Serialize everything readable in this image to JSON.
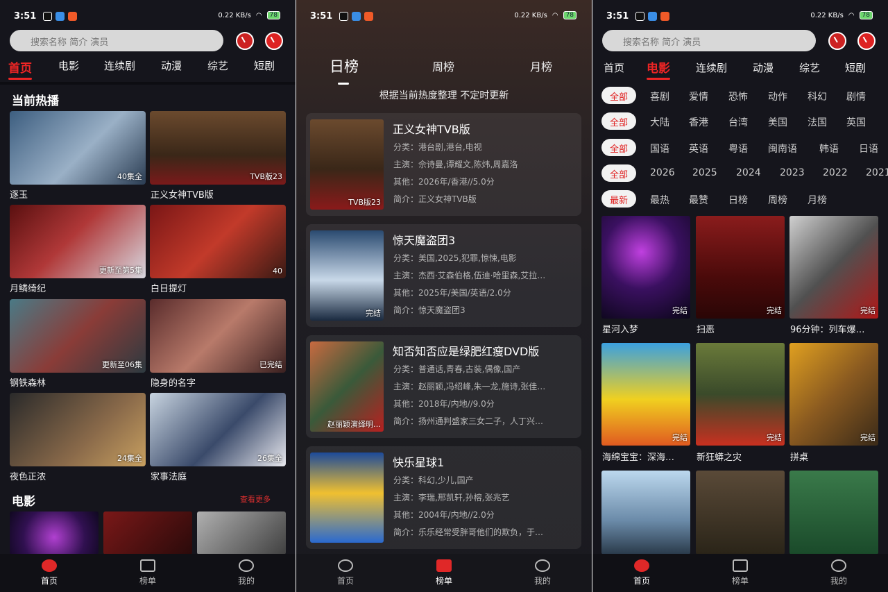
{
  "status": {
    "time": "3:51",
    "net_speed": "0.22 KB/s",
    "battery": "78"
  },
  "search": {
    "placeholder": "搜索名称 简介 演员"
  },
  "categories": [
    "首页",
    "电影",
    "连续剧",
    "动漫",
    "综艺",
    "短剧"
  ],
  "home": {
    "section_hot": "当前热播",
    "hot_items": [
      {
        "title": "逐玉",
        "badge": "40集全"
      },
      {
        "title": "正义女神TVB版",
        "badge": "TVB版23"
      },
      {
        "title": "月鳞绮纪",
        "badge": "更新至第5集"
      },
      {
        "title": "白日提灯",
        "badge": "40"
      },
      {
        "title": "钢铁森林",
        "badge": "更新至06集"
      },
      {
        "title": "隐身的名字",
        "badge": "已完结"
      },
      {
        "title": "夜色正浓",
        "badge": "24集全"
      },
      {
        "title": "家事法庭",
        "badge": "26集全"
      }
    ],
    "section_movie": "电影",
    "more_label": "查看更多"
  },
  "nav": [
    "首页",
    "榜单",
    "我的"
  ],
  "ranking": {
    "tabs": [
      "日榜",
      "周榜",
      "月榜"
    ],
    "subtitle": "根据当前热度整理 不定时更新",
    "items": [
      {
        "title": "正义女神TVB版",
        "category": "分类：港台剧,港台,电视",
        "cast": "主演：佘诗曼,谭耀文,陈炜,周嘉洛",
        "other": "其他：2026年/香港//5.0分",
        "intro": "简介：正义女神TVB版",
        "badge": "TVB版23"
      },
      {
        "title": "惊天魔盗团3",
        "category": "分类：美国,2025,犯罪,惊悚,电影",
        "cast": "主演：杰西·艾森伯格,伍迪·哈里森,艾拉…",
        "other": "其他：2025年/美国/英语/2.0分",
        "intro": "简介：惊天魔盗团3",
        "badge": "完结"
      },
      {
        "title": "知否知否应是绿肥红瘦DVD版",
        "category": "分类：普通话,青春,古装,偶像,国产",
        "cast": "主演：赵丽颖,冯绍峰,朱一龙,施诗,张佳…",
        "other": "其他：2018年/内地//9.0分",
        "intro": "简介：扬州通判盛家三女二子，人丁兴…",
        "badge": "赵丽颖演绎明…"
      },
      {
        "title": "快乐星球1",
        "category": "分类：科幻,少儿,国产",
        "cast": "主演：李瑞,邢凯轩,孙榕,张兆艺",
        "other": "其他：2004年/内地//2.0分",
        "intro": "简介：乐乐经常受胖哥他们的欺负，于…",
        "badge": ""
      }
    ]
  },
  "movies": {
    "filters": [
      {
        "chip": "全部",
        "options": [
          "喜剧",
          "爱情",
          "恐怖",
          "动作",
          "科幻",
          "剧情"
        ]
      },
      {
        "chip": "全部",
        "options": [
          "大陆",
          "香港",
          "台湾",
          "美国",
          "法国",
          "英国"
        ]
      },
      {
        "chip": "全部",
        "options": [
          "国语",
          "英语",
          "粤语",
          "闽南语",
          "韩语",
          "日语"
        ]
      },
      {
        "chip": "全部",
        "options": [
          "2026",
          "2025",
          "2024",
          "2023",
          "2022",
          "2021"
        ]
      },
      {
        "chip": "最新",
        "options": [
          "最热",
          "最赞",
          "日榜",
          "周榜",
          "月榜"
        ]
      }
    ],
    "items": [
      {
        "title": "星河入梦",
        "badge": "完结"
      },
      {
        "title": "扫恶",
        "badge": "完结"
      },
      {
        "title": "96分钟：列车爆…",
        "badge": "完结"
      },
      {
        "title": "海绵宝宝：深海…",
        "badge": "完结"
      },
      {
        "title": "新狂蟒之灾",
        "badge": "完结"
      },
      {
        "title": "拼桌",
        "badge": "完结"
      }
    ]
  },
  "colors": {
    "accent": "#ee2525",
    "bg": "#15151c"
  }
}
